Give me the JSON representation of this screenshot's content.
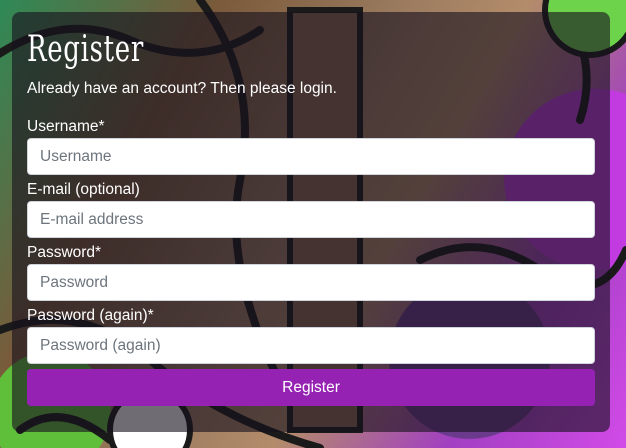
{
  "form": {
    "title": "Register",
    "subtitle": "Already have an account? Then please login.",
    "fields": [
      {
        "label": "Username*",
        "placeholder": "Username"
      },
      {
        "label": "E-mail (optional)",
        "placeholder": "E-mail address"
      },
      {
        "label": "Password*",
        "placeholder": "Password"
      },
      {
        "label": "Password (again)*",
        "placeholder": "Password (again)"
      }
    ],
    "submit_label": "Register"
  },
  "colors": {
    "panel_overlay": "#19121e",
    "button": "#9522b2",
    "text": "#ffffff"
  }
}
